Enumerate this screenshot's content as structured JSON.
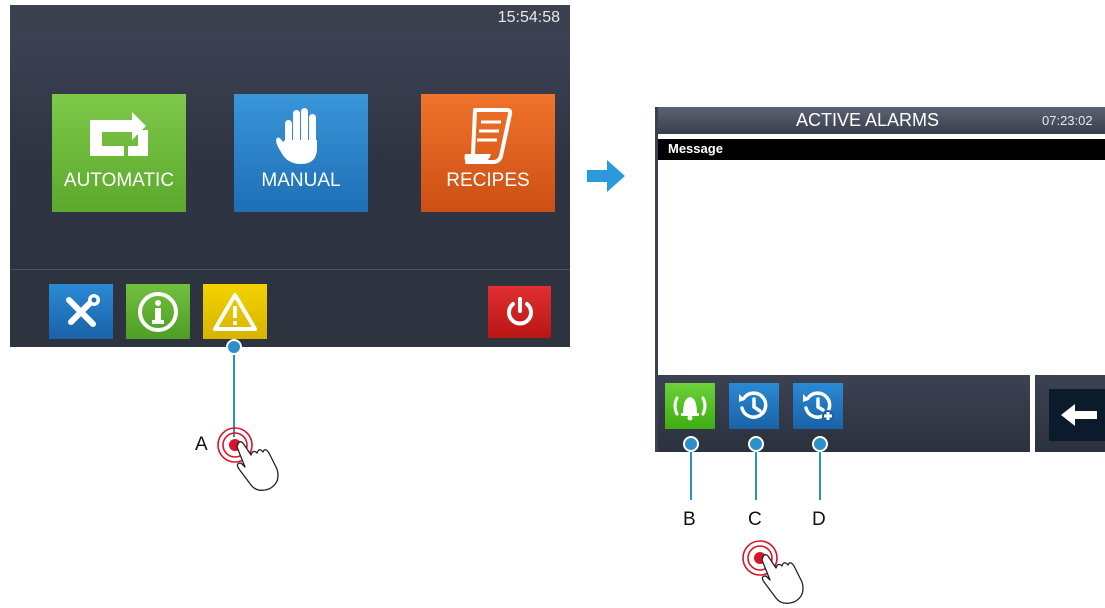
{
  "left_screen": {
    "time": "15:54:58",
    "tiles": {
      "automatic": "AUTOMATIC",
      "manual": "MANUAL",
      "recipes": "RECIPES"
    },
    "icons": [
      "wrench-screwdriver-icon",
      "info-icon",
      "warning-icon",
      "power-icon"
    ]
  },
  "right_screen": {
    "title": "ACTIVE ALARMS",
    "time": "07:23:02",
    "column_header": "Message",
    "icons": [
      "alarm-bell-icon",
      "history-icon",
      "history-plus-icon",
      "back-arrow-icon"
    ]
  },
  "callouts": {
    "a": "A",
    "b": "B",
    "c": "C",
    "d": "D"
  },
  "colors": {
    "green": "#5ca92d",
    "blue": "#1e6fb5",
    "orange": "#cc4f14",
    "yellow": "#d9b300",
    "red": "#b81515",
    "callout": "#2c8fcc"
  }
}
